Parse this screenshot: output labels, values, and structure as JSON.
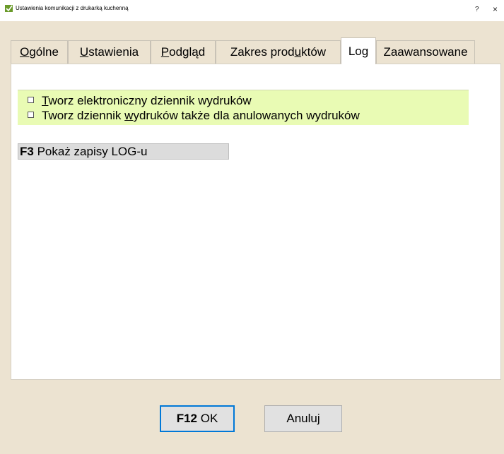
{
  "window": {
    "title": "Ustawienia komunikacji z drukarką kuchenną",
    "help": "?",
    "close": "×"
  },
  "tabs": [
    {
      "pre": "",
      "u": "O",
      "post": "gólne"
    },
    {
      "pre": "",
      "u": "U",
      "post": "stawienia"
    },
    {
      "pre": "",
      "u": "P",
      "post": "odgląd"
    },
    {
      "pre": "Zakres prod",
      "u": "u",
      "post": "któw"
    },
    {
      "pre": "Log",
      "u": "",
      "post": ""
    },
    {
      "pre": "Zaawansowane",
      "u": "",
      "post": ""
    }
  ],
  "active_tab": "Log",
  "log": {
    "options": [
      {
        "pre": "",
        "u": "T",
        "post": "worz elektroniczny dziennik wydruków",
        "checked": false
      },
      {
        "pre": "Tworz dziennik ",
        "u": "w",
        "post": "ydruków także dla anulowanych wydruków",
        "checked": false
      }
    ],
    "show_log_button": {
      "key": "F3",
      "label": " Pokaż zapisy LOG-u"
    }
  },
  "footer": {
    "ok": {
      "key": "F12",
      "label": " OK"
    },
    "cancel": {
      "label": "Anuluj"
    }
  },
  "colors": {
    "background": "#ece3d1",
    "options_highlight": "#e9fbb4",
    "ok_border": "#0078d7"
  }
}
